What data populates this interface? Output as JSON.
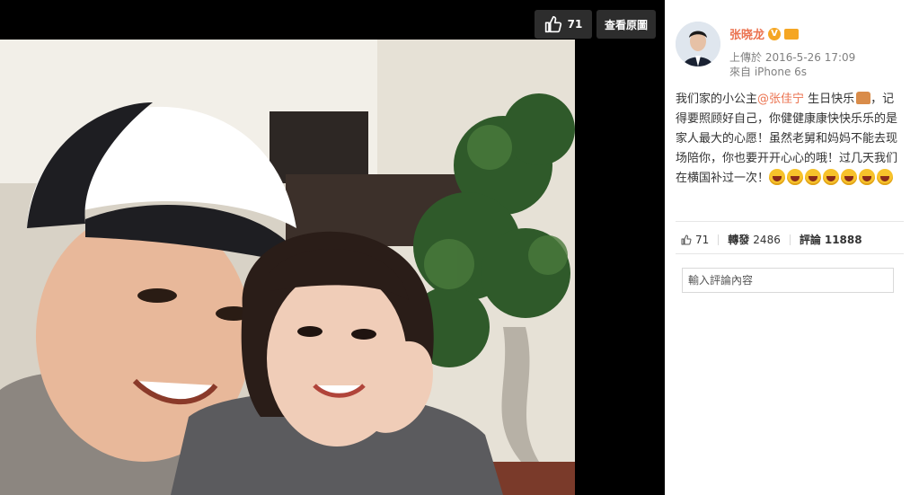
{
  "photo": {
    "like_count": "71",
    "view_original_label": "查看原圖"
  },
  "sidebar": {
    "username": "张晓龙",
    "verified_badge": "V",
    "upload_time": "上傳於 2016-5-26 17:09",
    "source": "來自 iPhone 6s",
    "post": {
      "text_before": "我们家的小公主",
      "mention": "@张佳宁",
      "text_after": " 生日快乐",
      "text_rest": "，记得要照顾好自己，你健健康康快快乐乐的是家人最大的心愿！虽然老舅和妈妈不能去现场陪你，你也要开开心心的哦！过几天我们在横国补过一次！"
    },
    "stats": {
      "like_count": "71",
      "repost_label": "轉發",
      "repost_count": "2486",
      "comment_label": "評論",
      "comment_count": "11888"
    },
    "comment_placeholder": "輸入評論內容"
  },
  "colors": {
    "accent": "#eb7350",
    "badge": "#f5a623",
    "photo_background": "#000000"
  },
  "icons": [
    "thumbs-up-icon",
    "verified-v-icon",
    "crown-badge-icon",
    "cake-icon",
    "laughing-emoji-icon"
  ]
}
